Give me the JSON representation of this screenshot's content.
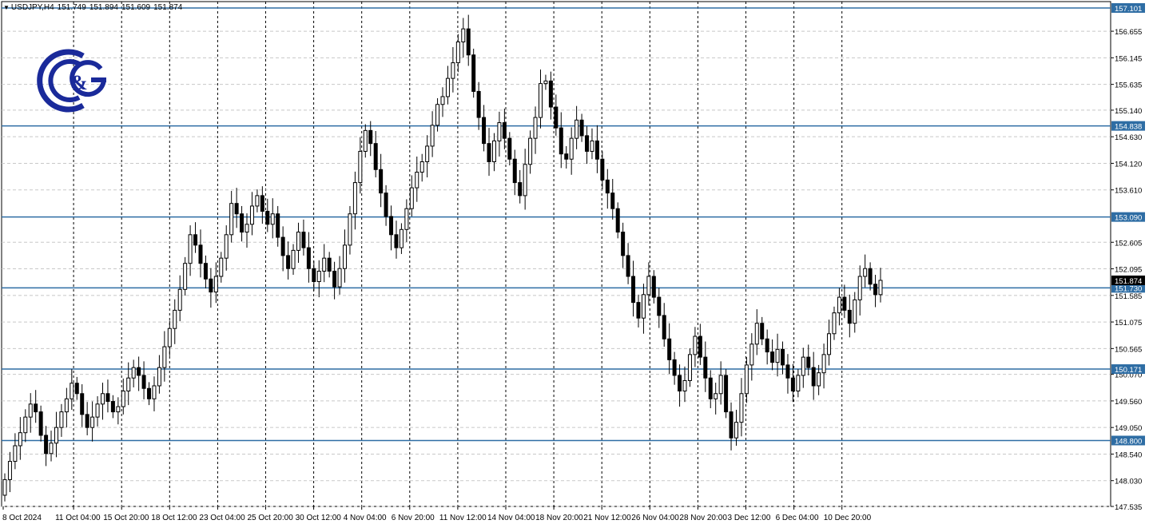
{
  "header": {
    "symbol": "USDJPY,H4",
    "open": "151.749",
    "high": "151.894",
    "low": "151.609",
    "close": "151.874"
  },
  "logo": {
    "name": "C&G logo",
    "text": "&"
  },
  "colors": {
    "grid": "#c8c8c8",
    "candle": "#000000",
    "level_line": "#2e6da4",
    "label_bg": "#2e6da4",
    "label_text": "#ffffff",
    "current_label_bg": "#000000",
    "logo": "#1a2a9a"
  },
  "chart_data": {
    "type": "candlestick",
    "title": "USDJPY,H4",
    "ylim": [
      147.535,
      157.101
    ],
    "y_ticks": [
      "156.655",
      "156.145",
      "155.635",
      "155.140",
      "154.630",
      "154.120",
      "153.610",
      "152.605",
      "152.095",
      "151.585",
      "151.075",
      "150.565",
      "150.070",
      "149.560",
      "149.050",
      "148.540",
      "148.030",
      "147.535"
    ],
    "x_ticks": [
      "8 Oct 2024",
      "11 Oct 04:00",
      "15 Oct 20:00",
      "18 Oct 12:00",
      "23 Oct 04:00",
      "25 Oct 20:00",
      "30 Oct 12:00",
      "4 Nov 04:00",
      "6 Nov 20:00",
      "11 Nov 12:00",
      "14 Nov 04:00",
      "18 Nov 20:00",
      "21 Nov 12:00",
      "26 Nov 04:00",
      "28 Nov 20:00",
      "3 Dec 12:00",
      "6 Dec 04:00",
      "10 Dec 20:00"
    ],
    "levels": [
      {
        "value": 157.101,
        "label": "157.101"
      },
      {
        "value": 154.838,
        "label": "154.838"
      },
      {
        "value": 153.09,
        "label": "153.090"
      },
      {
        "value": 151.73,
        "label": "151.730"
      },
      {
        "value": 150.171,
        "label": "150.171"
      },
      {
        "value": 148.8,
        "label": "148.800"
      }
    ],
    "current_price": {
      "value": 151.874,
      "label": "151.874"
    },
    "closes": [
      148.05,
      148.4,
      148.7,
      148.95,
      149.25,
      149.5,
      149.35,
      148.9,
      148.55,
      148.75,
      149.05,
      149.35,
      149.6,
      149.9,
      149.7,
      149.3,
      149.05,
      149.25,
      149.5,
      149.7,
      149.55,
      149.35,
      149.45,
      149.75,
      150.0,
      150.2,
      150.05,
      149.8,
      149.6,
      149.85,
      150.2,
      150.6,
      150.95,
      151.3,
      151.7,
      152.2,
      152.75,
      152.55,
      152.2,
      151.9,
      151.65,
      151.95,
      152.3,
      152.75,
      153.35,
      153.15,
      152.8,
      152.95,
      153.3,
      153.5,
      153.2,
      152.95,
      153.15,
      152.7,
      152.35,
      152.1,
      152.45,
      152.8,
      152.5,
      152.1,
      151.85,
      152.05,
      152.3,
      152.05,
      151.75,
      152.1,
      152.55,
      153.15,
      153.75,
      154.35,
      154.75,
      154.5,
      154.0,
      153.55,
      153.1,
      152.75,
      152.5,
      152.85,
      153.25,
      153.65,
      153.95,
      154.15,
      154.45,
      154.85,
      155.25,
      155.4,
      155.75,
      156.05,
      156.45,
      156.7,
      156.2,
      155.5,
      155.0,
      154.5,
      154.15,
      154.55,
      154.9,
      154.6,
      154.2,
      153.75,
      153.5,
      154.1,
      154.6,
      155.0,
      155.65,
      155.7,
      155.2,
      154.8,
      154.3,
      154.2,
      154.6,
      154.95,
      154.65,
      154.35,
      154.55,
      154.2,
      153.8,
      153.55,
      153.25,
      152.8,
      152.35,
      151.95,
      151.45,
      151.15,
      151.6,
      151.95,
      151.55,
      151.2,
      150.75,
      150.35,
      150.05,
      149.75,
      149.95,
      150.45,
      150.8,
      150.4,
      150.0,
      149.6,
      149.7,
      150.05,
      149.35,
      148.85,
      149.15,
      149.7,
      150.25,
      150.65,
      151.05,
      150.75,
      150.5,
      150.3,
      150.55,
      150.25,
      150.0,
      149.75,
      150.05,
      150.4,
      150.2,
      149.85,
      150.1,
      150.45,
      150.85,
      151.25,
      151.55,
      151.3,
      151.05,
      151.5,
      151.95,
      152.1,
      151.8,
      151.6,
      151.874
    ]
  }
}
